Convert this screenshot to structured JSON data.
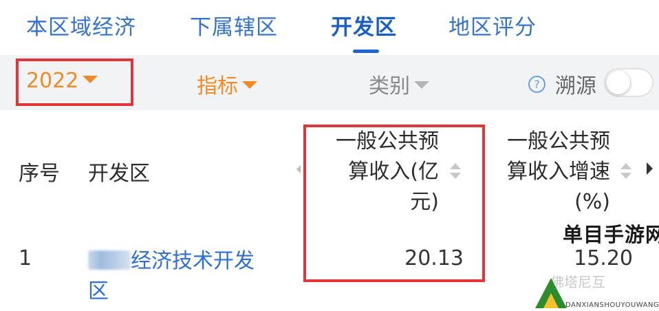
{
  "tabs": [
    {
      "label": "本区域经济",
      "active": false
    },
    {
      "label": "下属辖区",
      "active": false
    },
    {
      "label": "开发区",
      "active": true
    },
    {
      "label": "地区评分",
      "active": false
    }
  ],
  "filters": {
    "year": "2022",
    "indicator": "指标",
    "category": "类别",
    "help_icon": "?",
    "trace_label": "溯源",
    "trace_enabled": false
  },
  "table": {
    "headers": {
      "seq": "序号",
      "zone": "开发区",
      "revenue_line1": "一般公共预",
      "revenue_line2": "算收入(亿",
      "revenue_line3": "元)",
      "growth_line1": "一般公共预",
      "growth_line2": "算收入增速",
      "growth_line3": "(%)"
    },
    "rows": [
      {
        "seq": "1",
        "name_line1": "经济技术开发",
        "name_line2": "区",
        "revenue": "20.13",
        "growth": "15.20"
      }
    ]
  },
  "watermarks": {
    "wechat": "佛塔尼互",
    "logo_title": "单目手游网",
    "logo_subtitle": "DANXIANSHOUYOUWANG"
  },
  "colors": {
    "tab_blue": "#3572c9",
    "active_tab": "#1b5fbf",
    "orange": "#f08a24",
    "annotation_red": "#e0363a",
    "link_blue": "#2f6fcf"
  }
}
